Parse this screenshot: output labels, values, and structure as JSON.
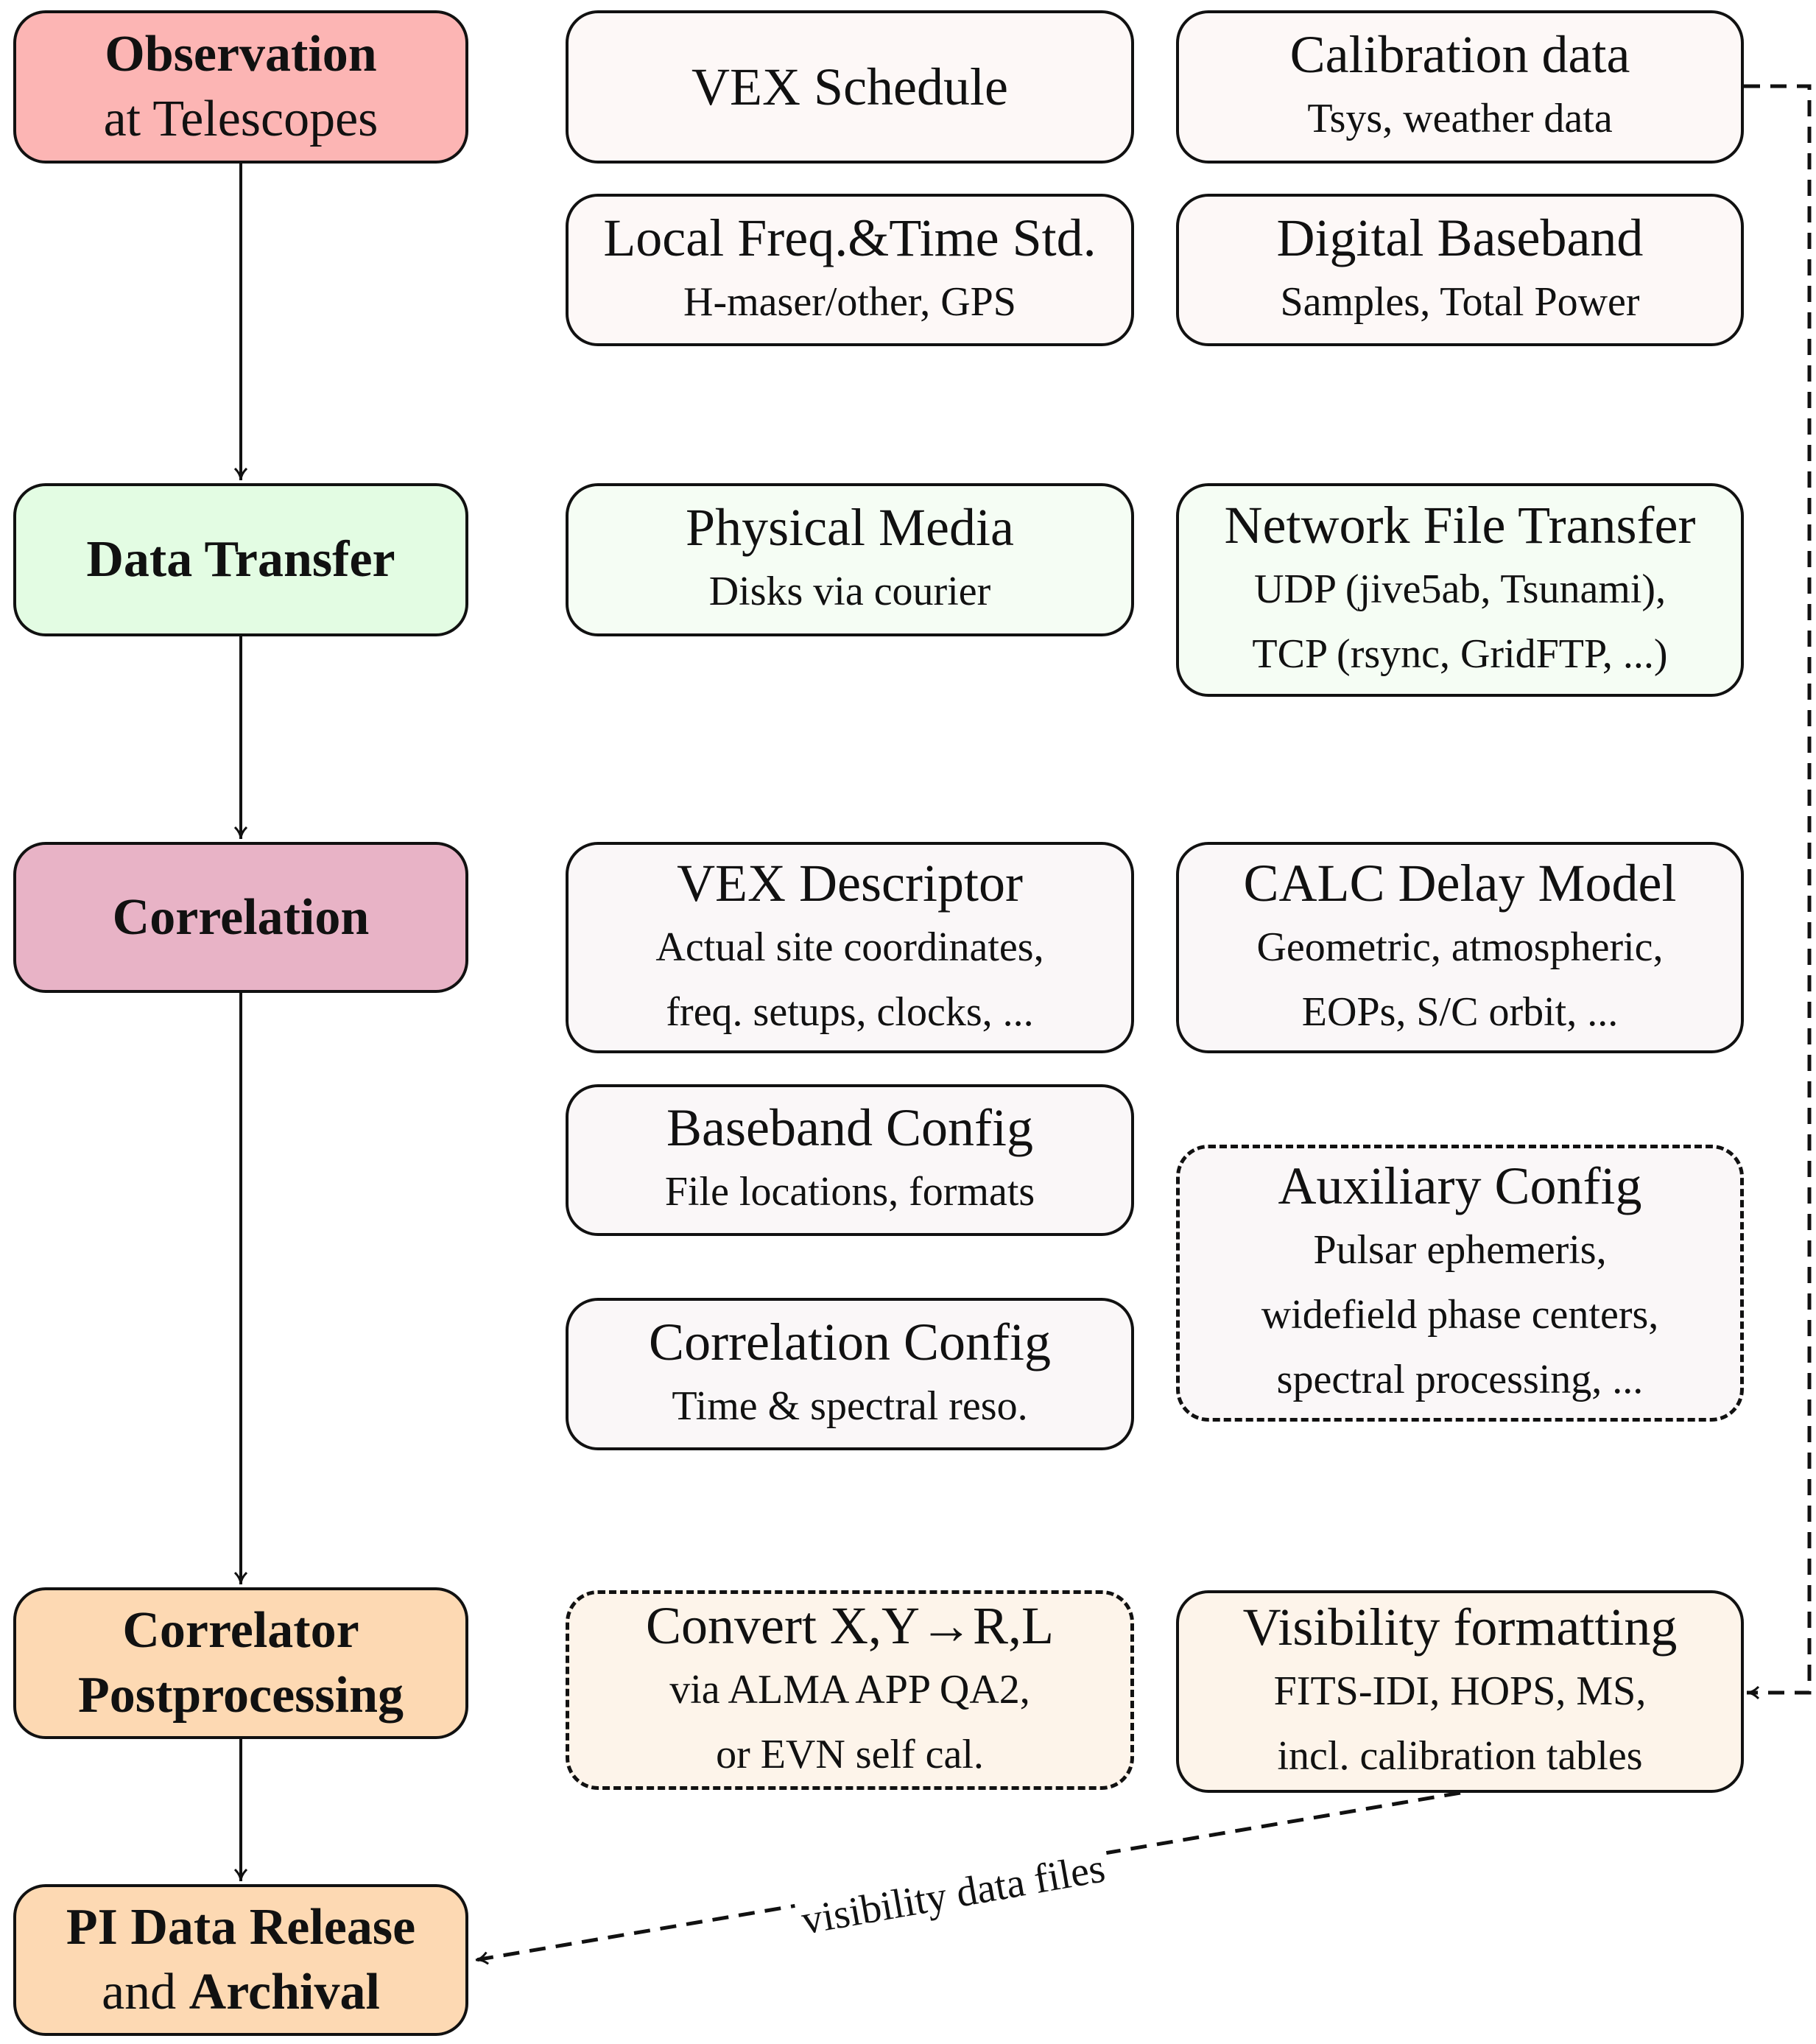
{
  "colors": {
    "observation": "#fcb5b4",
    "transfer": "#e3fce3",
    "correlation": "#e8b3c6",
    "postprocessing": "#fdd9b3",
    "observation_light": "#fdf8f7",
    "transfer_light": "#f5fdf4",
    "correlation_light": "#faf7f8",
    "postprocessing_light": "#fdf4ea"
  },
  "stages": {
    "observation": {
      "line1": "Observation",
      "line2": "at Telescopes"
    },
    "transfer": {
      "label": "Data Transfer"
    },
    "correlation": {
      "label": "Correlation"
    },
    "postprocessing": {
      "line1": "Correlator",
      "line2": "Postprocessing"
    },
    "release": {
      "line1": "PI Data Release",
      "line2_a": "and ",
      "line2_b": "Archival"
    }
  },
  "inputs": {
    "vex_schedule": {
      "title": "VEX Schedule"
    },
    "calibration": {
      "title": "Calibration data",
      "sub": "Tsys, weather data"
    },
    "local_freq": {
      "title": "Local Freq.&Time Std.",
      "sub": "H-maser/other, GPS"
    },
    "digital_baseband": {
      "title": "Digital Baseband",
      "sub": "Samples, Total Power"
    },
    "physical_media": {
      "title": "Physical Media",
      "sub": "Disks via courier"
    },
    "network_transfer": {
      "title": "Network File Transfer",
      "sub1": "UDP (jive5ab, Tsunami),",
      "sub2": "TCP (rsync, GridFTP, ...)"
    },
    "vex_descriptor": {
      "title": "VEX Descriptor",
      "sub1": "Actual site coordinates,",
      "sub2": "freq.  setups, clocks, ..."
    },
    "calc_delay": {
      "title": "CALC Delay Model",
      "sub1": "Geometric, atmospheric,",
      "sub2": "EOPs, S/C orbit, ..."
    },
    "baseband_config": {
      "title": "Baseband Config",
      "sub": "File locations, formats"
    },
    "auxiliary_config": {
      "title": "Auxiliary Config",
      "sub1": "Pulsar ephemeris,",
      "sub2": "widefield phase centers,",
      "sub3": "spectral processing, ..."
    },
    "correlation_config": {
      "title": "Correlation Config",
      "sub": "Time & spectral reso."
    },
    "convert_pol": {
      "title": "Convert X,Y→R,L",
      "sub1": "via ALMA APP QA2,",
      "sub2": "or EVN self cal."
    },
    "visibility_formatting": {
      "title": "Visibility formatting",
      "sub1": "FITS-IDI, HOPS, MS,",
      "sub2": "incl.  calibration tables"
    }
  },
  "edges": {
    "visibility_files_label": "visibility data files"
  }
}
